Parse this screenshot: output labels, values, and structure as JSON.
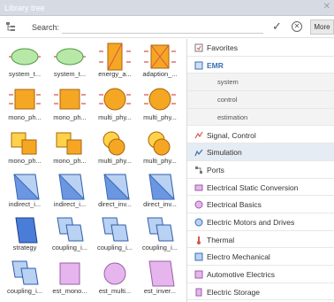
{
  "window": {
    "title": "Library tree"
  },
  "search": {
    "label": "Search:",
    "value": "",
    "more_label": "More"
  },
  "colors": {
    "orange": "#f5a623",
    "yellow": "#ffd24a",
    "green": "#b8e8a8",
    "blue": "#4a7dd8",
    "lightblue": "#b9d1f3",
    "pink": "#e6b5ee",
    "red": "#d9534f",
    "selected_row": "#e6ecf3"
  },
  "library_items": [
    {
      "label": "system_t...",
      "icon": "green-ellipse-block"
    },
    {
      "label": "system_t...",
      "icon": "green-ellipse-block"
    },
    {
      "label": "energy_a...",
      "icon": "orange-energy-accumulation-block"
    },
    {
      "label": "adaption_...",
      "icon": "orange-adaptation-block"
    },
    {
      "label": "mono_ph...",
      "icon": "orange-square-block"
    },
    {
      "label": "mono_ph...",
      "icon": "orange-square-block"
    },
    {
      "label": "multi_phy...",
      "icon": "orange-circle-block"
    },
    {
      "label": "multi_phy...",
      "icon": "orange-circle-block"
    },
    {
      "label": "mono_ph...",
      "icon": "orange-coupling-squares-block"
    },
    {
      "label": "mono_ph...",
      "icon": "orange-coupling-squares-block"
    },
    {
      "label": "multi_phy...",
      "icon": "orange-coupling-circles-block"
    },
    {
      "label": "multi_phy...",
      "icon": "orange-coupling-circles-block"
    },
    {
      "label": "indirect_i...",
      "icon": "blue-inversion-block"
    },
    {
      "label": "indirect_i...",
      "icon": "blue-inversion-block"
    },
    {
      "label": "direct_inv...",
      "icon": "blue-inversion-block"
    },
    {
      "label": "direct_inv...",
      "icon": "blue-inversion-block"
    },
    {
      "label": "strategy",
      "icon": "blue-strategy-block"
    },
    {
      "label": "coupling_i...",
      "icon": "blue-coupling-block"
    },
    {
      "label": "coupling_i...",
      "icon": "blue-coupling-block"
    },
    {
      "label": "coupling_i...",
      "icon": "blue-coupling-block"
    },
    {
      "label": "coupling_i...",
      "icon": "blue-coupling-block"
    },
    {
      "label": "est_mono...",
      "icon": "pink-estimation-block"
    },
    {
      "label": "est_multi...",
      "icon": "pink-estimation-circle-block"
    },
    {
      "label": "est_inver...",
      "icon": "pink-estimation-inversion-block"
    }
  ],
  "tree": [
    {
      "label": "Favorites",
      "icon": "favorites-icon",
      "kind": "top"
    },
    {
      "label": "EMR",
      "icon": "emr-icon",
      "kind": "emr"
    },
    {
      "label": "system",
      "kind": "sub"
    },
    {
      "label": "control",
      "kind": "sub"
    },
    {
      "label": "estimation",
      "kind": "sub"
    },
    {
      "label": "Signal, Control",
      "icon": "signal-icon",
      "kind": "top"
    },
    {
      "label": "Simulation",
      "icon": "simulation-icon",
      "kind": "selected"
    },
    {
      "label": "Ports",
      "icon": "ports-icon",
      "kind": "top"
    },
    {
      "label": "Electrical Static Conversion",
      "icon": "static-conversion-icon",
      "kind": "top"
    },
    {
      "label": "Electrical Basics",
      "icon": "electrical-basics-icon",
      "kind": "top"
    },
    {
      "label": "Electric Motors and Drives",
      "icon": "motor-icon",
      "kind": "top"
    },
    {
      "label": "Thermal",
      "icon": "thermal-icon",
      "kind": "top"
    },
    {
      "label": "Electro Mechanical",
      "icon": "electro-mechanical-icon",
      "kind": "top"
    },
    {
      "label": "Automotive Electrics",
      "icon": "automotive-icon",
      "kind": "top"
    },
    {
      "label": "Electric Storage",
      "icon": "storage-icon",
      "kind": "top"
    }
  ]
}
